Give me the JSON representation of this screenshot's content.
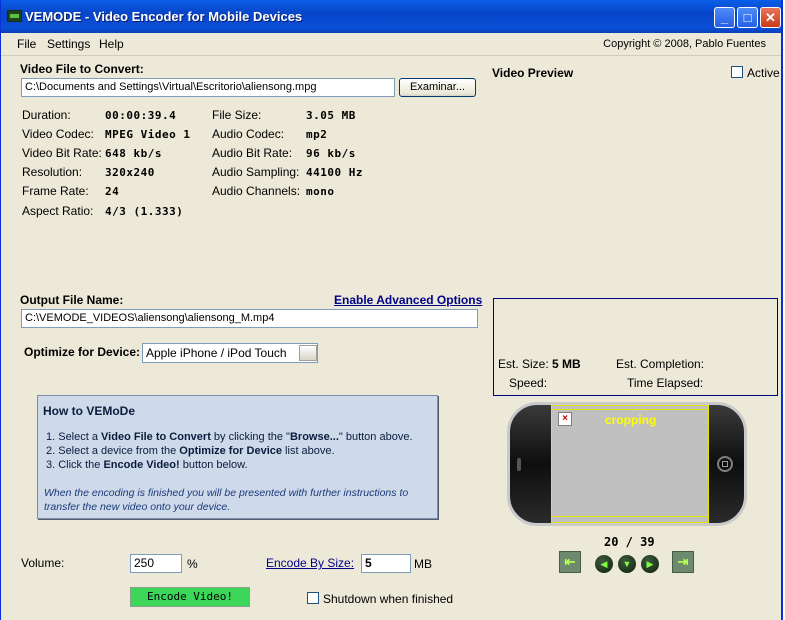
{
  "window": {
    "title": "VEMODE - Video Encoder for Mobile Devices"
  },
  "menu": {
    "file": "File",
    "settings": "Settings",
    "help": "Help",
    "copyright": "Copyright © 2008, Pablo Fuentes"
  },
  "input": {
    "label": "Video File to Convert:",
    "path": "C:\\Documents and Settings\\Virtual\\Escritorio\\aliensong.mpg",
    "browse_label": "Examinar..."
  },
  "info": {
    "duration_label": "Duration:",
    "duration": "00:00:39.4",
    "video_codec_label": "Video Codec:",
    "video_codec": "MPEG Video 1",
    "video_bitrate_label": "Video Bit Rate:",
    "video_bitrate": "648 kb/s",
    "resolution_label": "Resolution:",
    "resolution": "320x240",
    "frame_rate_label": "Frame Rate:",
    "frame_rate": "24",
    "aspect_label": "Aspect Ratio:",
    "aspect": "4/3 (1.333)",
    "file_size_label": "File Size:",
    "file_size": "3.05 MB",
    "audio_codec_label": "Audio Codec:",
    "audio_codec": "mp2",
    "audio_bitrate_label": "Audio Bit Rate:",
    "audio_bitrate": "96 kb/s",
    "audio_sampling_label": "Audio Sampling:",
    "audio_sampling": "44100 Hz",
    "audio_channels_label": "Audio Channels:",
    "audio_channels": "mono"
  },
  "preview": {
    "label": "Video Preview",
    "active_label": "Active",
    "overlay": "cropping",
    "frame": "20 / 39"
  },
  "output": {
    "label": "Output File Name:",
    "advanced_link": "Enable Advanced Options",
    "path": "C:\\VEMODE_VIDEOS\\aliensong\\aliensong_M.mp4",
    "device_label": "Optimize for Device:",
    "device": "Apple iPhone / iPod Touch"
  },
  "howto": {
    "title": "How to VEMoDe",
    "step1_num": "1. Select a ",
    "step1_b1": "Video File to Convert",
    "step1_mid": " by clicking the \"",
    "step1_b2": "Browse...",
    "step1_end": "\" button above.",
    "step2_num": "2. Select a device from the ",
    "step2_b": "Optimize for Device",
    "step2_end": " list above.",
    "step3_num": "3. Click the ",
    "step3_b": "Encode Video!",
    "step3_end": " button below.",
    "note1": "When the encoding is finished you will be presented with further instructions to",
    "note2": "transfer the new video onto your device."
  },
  "stats": {
    "est_size_label": "Est. Size:",
    "est_size": "5 MB",
    "speed_label": "Speed:",
    "est_completion_label": "Est. Completion:",
    "time_elapsed_label": "Time Elapsed:"
  },
  "controls": {
    "volume_label": "Volume:",
    "volume": "250",
    "volume_unit": "%",
    "encode_by_size_label": "Encode By Size:",
    "encode_size": "5",
    "encode_size_unit": "MB",
    "encode_button": "Encode Video!",
    "shutdown_label": "Shutdown when finished"
  }
}
